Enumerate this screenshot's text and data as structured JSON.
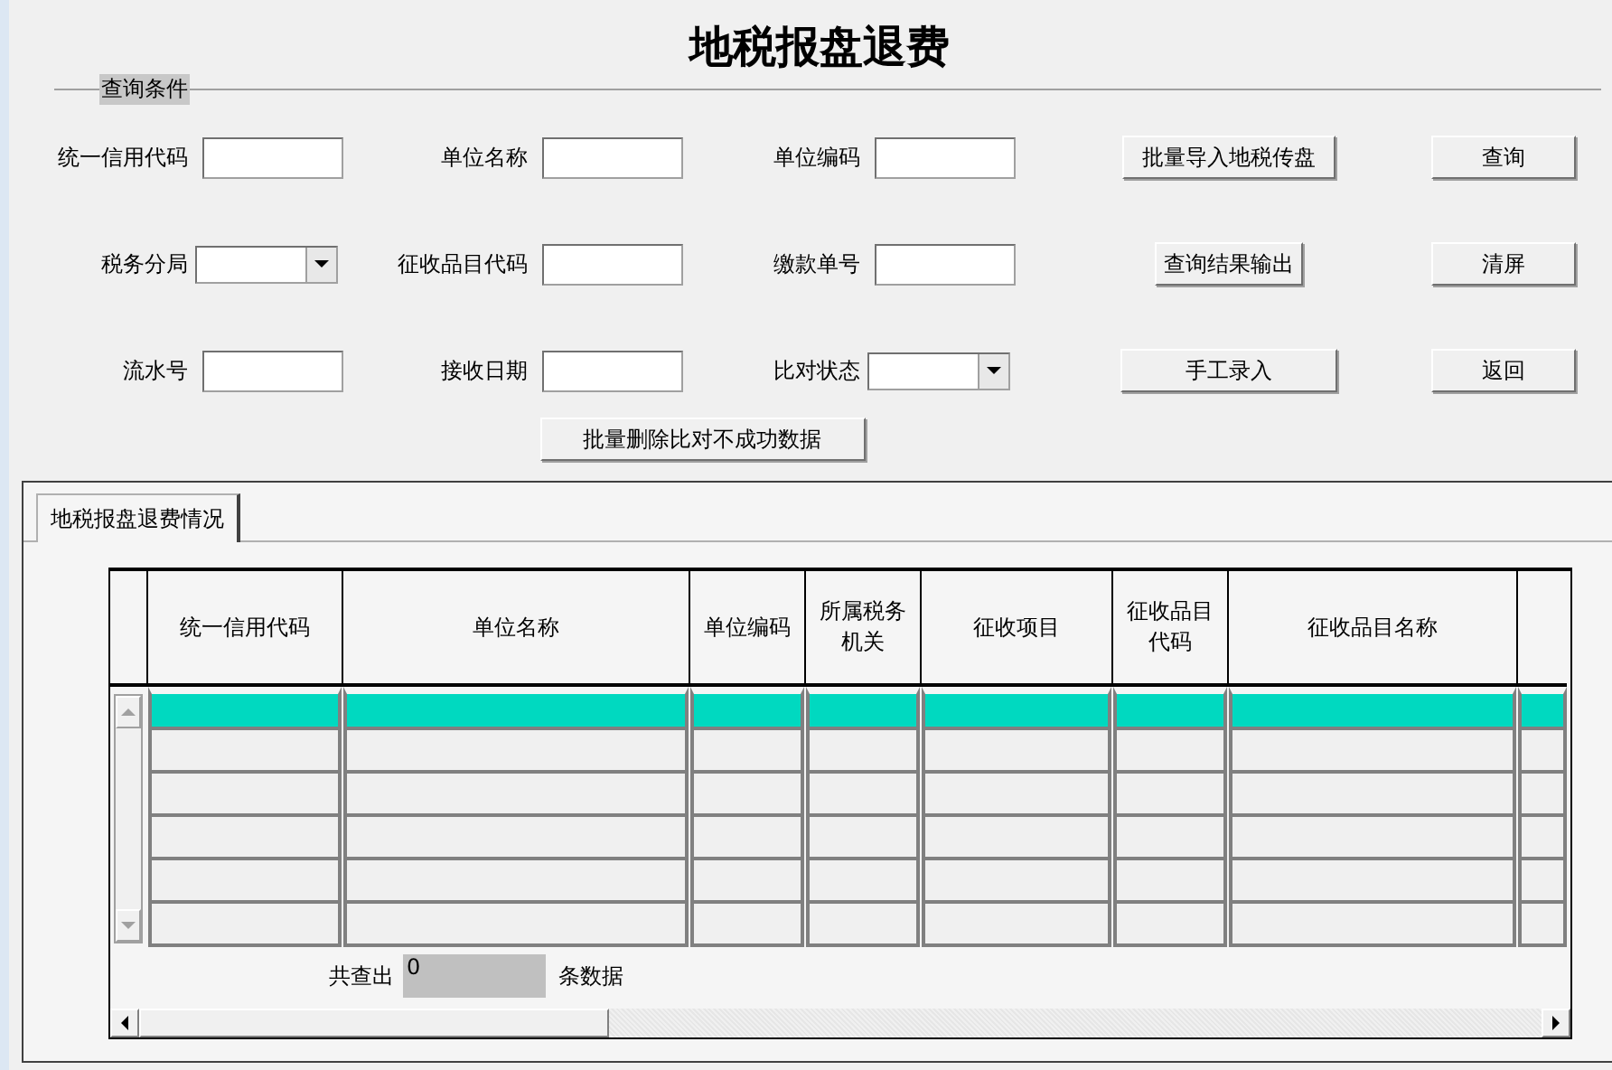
{
  "title": "地税报盘退费",
  "query": {
    "legend": "查询条件",
    "rows": [
      {
        "fields": [
          {
            "label": "统一信用代码",
            "kind": "text"
          },
          {
            "label": "单位名称",
            "kind": "text"
          },
          {
            "label": "单位编码",
            "kind": "text"
          }
        ],
        "action": "批量导入地税传盘",
        "side": "查询"
      },
      {
        "fields": [
          {
            "label": "税务分局",
            "kind": "select"
          },
          {
            "label": "征收品目代码",
            "kind": "text"
          },
          {
            "label": "缴款单号",
            "kind": "text"
          }
        ],
        "action": "查询结果输出",
        "side": "清屏"
      },
      {
        "fields": [
          {
            "label": "流水号",
            "kind": "text"
          },
          {
            "label": "接收日期",
            "kind": "text"
          },
          {
            "label": "比对状态",
            "kind": "select"
          }
        ],
        "action": "手工录入",
        "side": "返回"
      }
    ],
    "bulk_delete": "批量删除比对不成功数据"
  },
  "tabs": [
    {
      "label": "地税报盘退费情况",
      "selected": true
    }
  ],
  "table": {
    "columns": [
      "统一信用代码",
      "单位名称",
      "单位编码",
      "所属税务机关",
      "征收项目",
      "征收品目代码",
      "征收品目名称"
    ],
    "rows": [
      {
        "selected": true
      },
      {
        "selected": false
      },
      {
        "selected": false
      },
      {
        "selected": false
      },
      {
        "selected": false
      },
      {
        "selected": false
      }
    ]
  },
  "footer": {
    "prefix": "共查出",
    "value": "0",
    "suffix": "条数据"
  }
}
